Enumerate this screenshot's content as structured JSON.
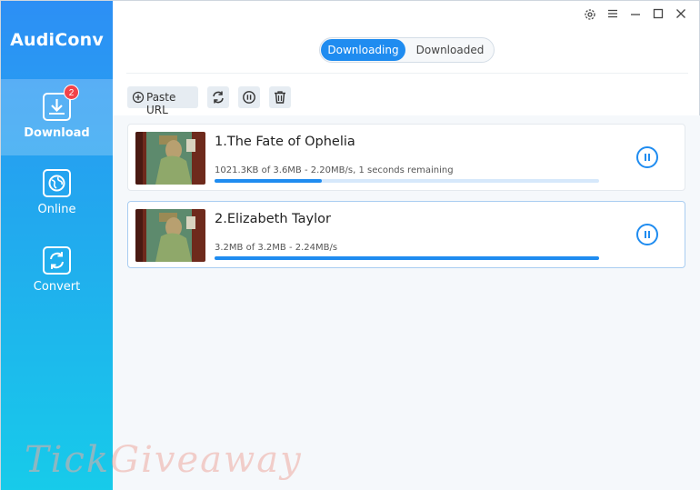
{
  "app": {
    "title": "AudiConv"
  },
  "sidebar": {
    "items": [
      {
        "label": "Download",
        "icon": "download-icon",
        "badge": "2",
        "active": true
      },
      {
        "label": "Online",
        "icon": "globe-icon",
        "active": false
      },
      {
        "label": "Convert",
        "icon": "convert-icon",
        "active": false
      }
    ]
  },
  "window_controls": [
    "gear-icon",
    "menu-icon",
    "minimize-icon",
    "maximize-icon",
    "close-icon"
  ],
  "tabs": {
    "active": "Downloading",
    "inactive": "Downloaded"
  },
  "toolbar": {
    "paste_label": "Paste URL",
    "buttons": [
      "refresh-icon",
      "pause-all-icon",
      "delete-icon"
    ]
  },
  "downloads": [
    {
      "title": "1.The Fate of Ophelia",
      "status": "1021.3KB of 3.6MB -    2.20MB/s, 1 seconds remaining",
      "progress": 0.28
    },
    {
      "title": "2.Elizabeth Taylor",
      "status": "3.2MB of 3.2MB -    2.24MB/s",
      "progress": 1.0
    }
  ],
  "watermark": "TickGiveaway",
  "colors": {
    "accent": "#1f8cf0",
    "badge": "#f2434a",
    "sidebar_top": "#2d8ff5",
    "sidebar_bottom": "#17cbea"
  }
}
